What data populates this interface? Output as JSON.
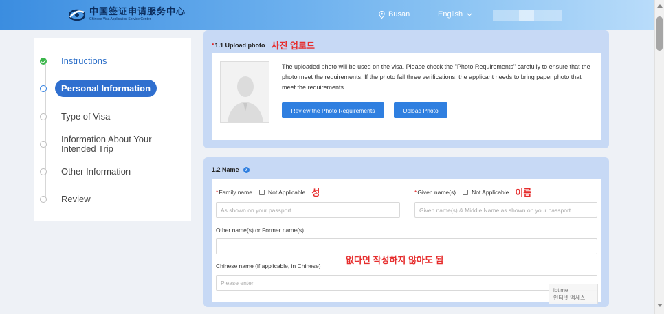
{
  "header": {
    "logo_cn": "中国签证申请服务中心",
    "logo_en": "Chinese Visa Application Service Center",
    "location": "Busan",
    "language": "English"
  },
  "sidebar": {
    "steps": [
      {
        "label": "Instructions",
        "state": "done"
      },
      {
        "label": "Personal Information",
        "state": "active"
      },
      {
        "label": "Type of Visa",
        "state": "pending"
      },
      {
        "label": "Information About Your Intended Trip",
        "state": "pending"
      },
      {
        "label": "Other Information",
        "state": "pending"
      },
      {
        "label": "Review",
        "state": "pending"
      }
    ]
  },
  "upload": {
    "required_mark": "*",
    "title": "1.1 Upload photo",
    "note_ko": "사진 업로드",
    "description": "The uploaded photo will be used on the visa. Please check the \"Photo Requirements\" carefully to ensure that the photo meet the requirements. If the photo fail three verifications, the applicant needs to bring paper photo that meet the requirements.",
    "review_button": "Review the Photo Requirements",
    "upload_button": "Upload Photo"
  },
  "name": {
    "title": "1.2 Name",
    "help_icon": "?",
    "family_name_label": "Family name",
    "given_name_label": "Given name(s)",
    "not_applicable": "Not Applicable",
    "note_family_ko": "성",
    "note_given_ko": "이름",
    "family_placeholder": "As shown on your passport",
    "given_placeholder": "Given name(s) & Middle Name as shown on your passport",
    "other_names_label": "Other name(s) or Former name(s)",
    "note_optional_ko": "없다면 작성하지 않아도 됨",
    "chinese_name_label": "Chinese name (if applicable, in Chinese)",
    "chinese_placeholder": "Please enter"
  },
  "overlay": {
    "line1": "iptime",
    "line2": "인터넷 액세스"
  },
  "colors": {
    "primary": "#2f7fe0",
    "panel_bg": "#c7d9f5",
    "done": "#3ab54a",
    "annotation": "#e62e2e"
  }
}
